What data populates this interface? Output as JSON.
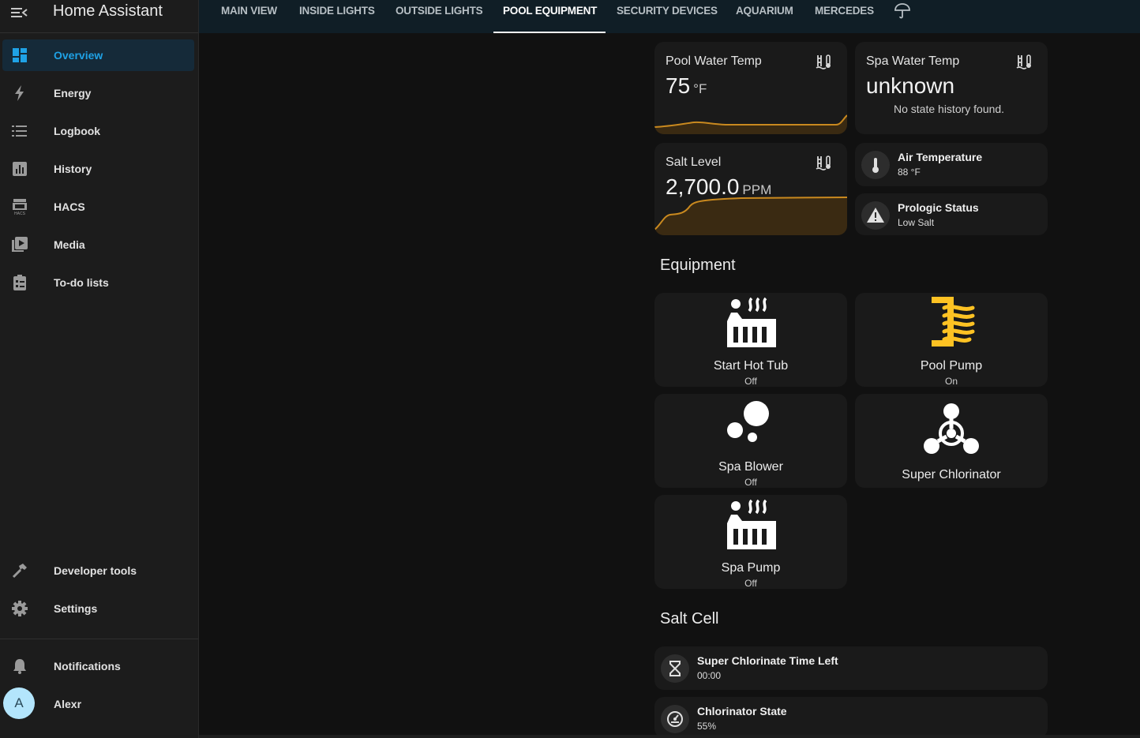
{
  "app": {
    "title": "Home Assistant"
  },
  "sidebar": {
    "items": [
      {
        "label": "Overview",
        "icon": "dashboard-icon"
      },
      {
        "label": "Energy",
        "icon": "lightning-icon"
      },
      {
        "label": "Logbook",
        "icon": "list-icon"
      },
      {
        "label": "History",
        "icon": "chart-icon"
      },
      {
        "label": "HACS",
        "icon": "hacs-icon"
      },
      {
        "label": "Media",
        "icon": "media-icon"
      },
      {
        "label": "To-do lists",
        "icon": "clipboard-icon"
      }
    ],
    "developer_tools": "Developer tools",
    "settings": "Settings",
    "notifications": "Notifications",
    "user": {
      "name": "Alexr",
      "initial": "A"
    }
  },
  "tabs": [
    {
      "label": "MAIN VIEW"
    },
    {
      "label": "INSIDE LIGHTS"
    },
    {
      "label": "OUTSIDE LIGHTS"
    },
    {
      "label": "POOL EQUIPMENT"
    },
    {
      "label": "SECURITY DEVICES"
    },
    {
      "label": "AQUARIUM"
    },
    {
      "label": "MERCEDES"
    }
  ],
  "sensors": {
    "pool_temp": {
      "title": "Pool Water Temp",
      "value": "75",
      "unit": "°F"
    },
    "spa_temp": {
      "title": "Spa Water Temp",
      "value": "unknown",
      "note": "No state history found."
    },
    "salt": {
      "title": "Salt Level",
      "value": "2,700.0",
      "unit": "PPM"
    },
    "air_temp": {
      "name": "Air Temperature",
      "state": "88 °F"
    },
    "prologic": {
      "name": "Prologic Status",
      "state": "Low Salt"
    }
  },
  "equipment": {
    "heading": "Equipment",
    "buttons": [
      {
        "name": "Start Hot Tub",
        "state": "Off",
        "icon": "hot-tub-icon"
      },
      {
        "name": "Pool Pump",
        "state": "On",
        "icon": "pump-icon"
      },
      {
        "name": "Spa Blower",
        "state": "Off",
        "icon": "bubbles-icon"
      },
      {
        "name": "Super Chlorinator",
        "state": "",
        "icon": "biohazard-icon"
      },
      {
        "name": "Spa Pump",
        "state": "Off",
        "icon": "hot-tub-icon"
      }
    ]
  },
  "salt_cell": {
    "heading": "Salt Cell",
    "rows": [
      {
        "name": "Super Chlorinate Time Left",
        "state": "00:00",
        "icon": "hourglass-icon"
      },
      {
        "name": "Chlorinator State",
        "state": "55%",
        "icon": "gauge-icon"
      }
    ]
  },
  "colors": {
    "accent": "#1fa2e6",
    "graph": "#c9891f",
    "pump_on": "#fdc223"
  }
}
